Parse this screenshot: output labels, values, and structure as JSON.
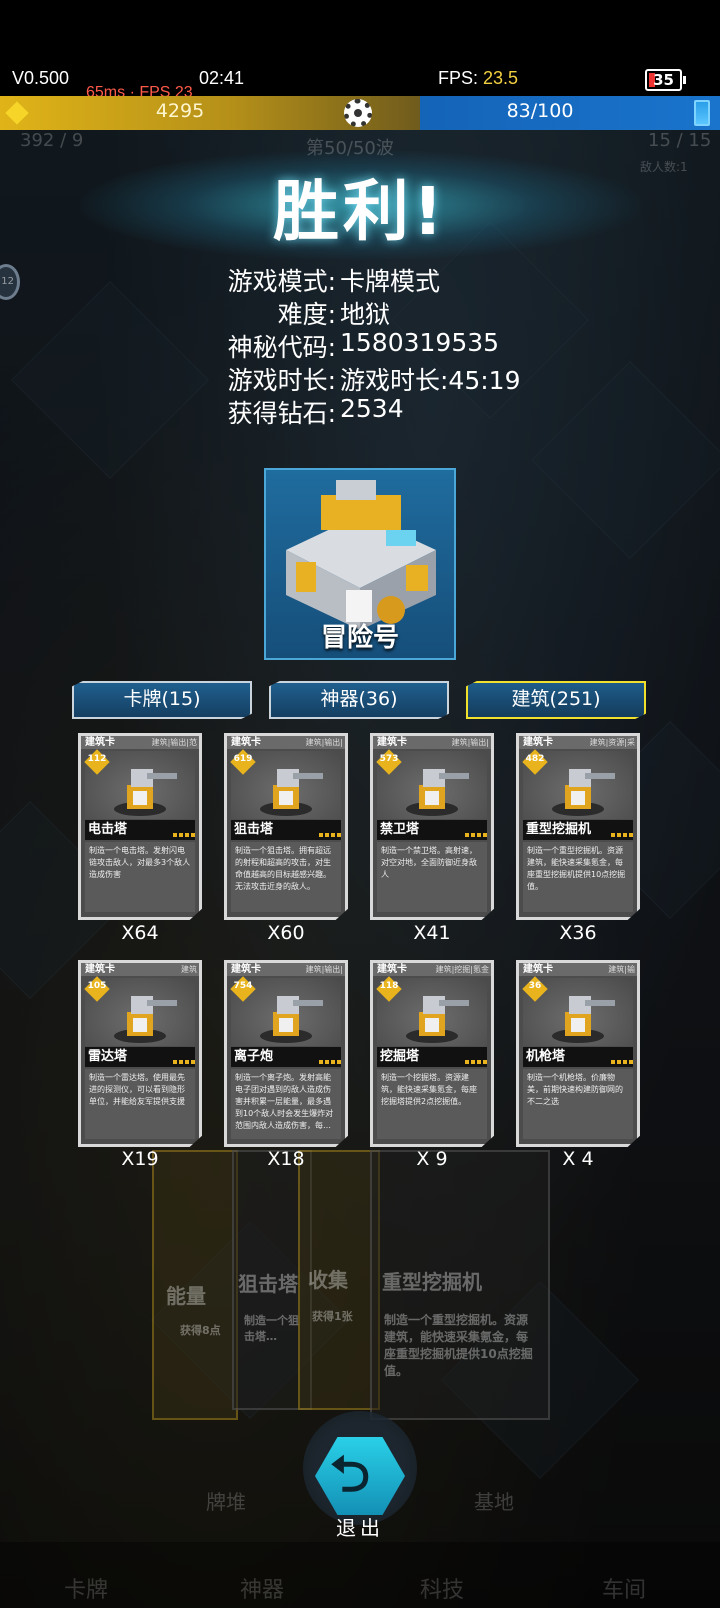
{
  "status_bar": {
    "version": "V0.500",
    "network": "65ms · FPS 23",
    "clock": "02:41",
    "fps_label": "FPS:",
    "fps_value": "23.5",
    "battery": "35"
  },
  "resources": {
    "gold": "4295",
    "energy": "83/100"
  },
  "hud_ghost": {
    "left_counter": "392 / 9",
    "wave": "第50/50波",
    "right_counter": "15 / 15",
    "enemy_count": "敌人数:1",
    "side_badge": "12"
  },
  "result": {
    "title": "胜利!",
    "rows": [
      {
        "label": "游戏模式:",
        "value": "卡牌模式"
      },
      {
        "label": "难度:",
        "value": "地狱"
      },
      {
        "label": "神秘代码:",
        "value": "1580319535"
      },
      {
        "label": "游戏时长:",
        "value": "游戏时长:45:19"
      },
      {
        "label": "获得钻石:",
        "value": "2534"
      }
    ]
  },
  "portrait": {
    "name": "冒险号"
  },
  "tabs": [
    {
      "label": "卡牌(15)",
      "active": false
    },
    {
      "label": "神器(36)",
      "active": false
    },
    {
      "label": "建筑(251)",
      "active": true
    }
  ],
  "cards": [
    {
      "type": "建筑卡",
      "tags": "建筑|输出|范",
      "cost": "112",
      "name": "电击塔",
      "desc": "制造一个电击塔。发射闪电链攻击敌人，对最多3个敌人造成伤害",
      "count": "X64"
    },
    {
      "type": "建筑卡",
      "tags": "建筑|输出|",
      "cost": "619",
      "name": "狙击塔",
      "desc": "制造一个狙击塔。拥有超远的射程和超高的攻击，对生命值越高的目标越感兴趣。无法攻击近身的敌人。",
      "count": "X60"
    },
    {
      "type": "建筑卡",
      "tags": "建筑|输出|",
      "cost": "573",
      "name": "禁卫塔",
      "desc": "制造一个禁卫塔。高射速，对空对地，全面防御近身敌人",
      "count": "X41"
    },
    {
      "type": "建筑卡",
      "tags": "建筑|资源|采",
      "cost": "482",
      "name": "重型挖掘机",
      "desc": "制造一个重型挖掘机。资源建筑，能快速采集氪金，每座重型挖掘机提供10点挖掘值。",
      "count": "X36"
    },
    {
      "type": "建筑卡",
      "tags": "建筑",
      "cost": "105",
      "name": "雷达塔",
      "desc": "制造一个雷达塔。使用最先进的探测仪，可以看到隐形单位，并能给友军提供支援",
      "count": "X19"
    },
    {
      "type": "建筑卡",
      "tags": "建筑|输出|",
      "cost": "754",
      "name": "离子炮",
      "desc": "制造一个离子炮。发射高能电子团对遇到的敌人造成伤害并积累一层能量，最多遇到10个敌人时会发生爆炸对范围内敌人造成伤害，每…",
      "count": "X18"
    },
    {
      "type": "建筑卡",
      "tags": "建筑|挖掘|氪金",
      "cost": "118",
      "name": "挖掘塔",
      "desc": "制造一个挖掘塔。资源建筑，能快速采集氪金，每座挖掘塔提供2点挖掘值。",
      "count": "X 9"
    },
    {
      "type": "建筑卡",
      "tags": "建筑|输",
      "cost": "36",
      "name": "机枪塔",
      "desc": "制造一个机枪塔。价廉物美，前期快速构建防御网的不二之选",
      "count": "X 4"
    }
  ],
  "background_cards": [
    {
      "label": "能量",
      "sub": "获得8点"
    },
    {
      "label": "狙击塔",
      "sub": "制造一个狙击塔…"
    },
    {
      "label": "收集",
      "sub": "获得1张"
    },
    {
      "label": "重型挖掘机",
      "sub": "制造一个重型挖掘机。资源建筑，能快速采集氪金，每座重型挖掘机提供10点挖掘值。"
    }
  ],
  "exit": {
    "label": "退出",
    "arrow": "⮌"
  },
  "bottom_nav": [
    "卡牌",
    "神器",
    "科技",
    "车间"
  ],
  "bottom_mid": [
    "牌堆",
    "基地"
  ],
  "colors": {
    "gold": "#e0b418",
    "energy": "#1464b8",
    "accent": "#f1e12c",
    "glow": "#3cc8dc"
  }
}
